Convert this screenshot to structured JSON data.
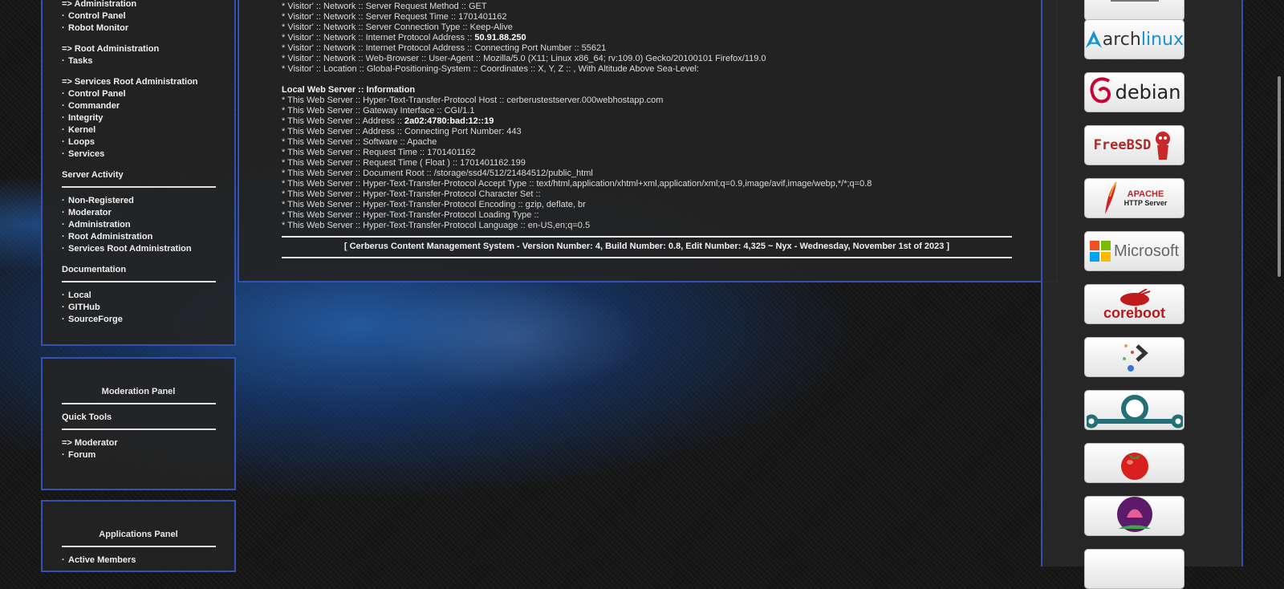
{
  "nav_panel": {
    "top_links": [
      {
        "label": "=> Administration",
        "bullet": false
      },
      {
        "label": "Control Panel",
        "bullet": true
      },
      {
        "label": "Robot Monitor",
        "bullet": true
      }
    ],
    "root_admin": {
      "head": "=> Root Administration",
      "items": [
        "Tasks"
      ]
    },
    "services_root": {
      "head": "=> Services Root Administration",
      "items": [
        "Control Panel",
        "Commander",
        "Integrity",
        "Kernel",
        "Loops",
        "Services"
      ]
    },
    "server_activity": {
      "title": "Server Activity",
      "items": [
        "Non-Registered",
        "Moderator",
        "Administration",
        "Root Administration",
        "Services Root Administration"
      ]
    },
    "documentation": {
      "title": "Documentation",
      "items": [
        "Local",
        "GITHub",
        "SourceForge"
      ]
    }
  },
  "moderation_panel": {
    "title": "Moderation Panel",
    "quick_tools": "Quick Tools",
    "head": "=> Moderator",
    "items": [
      "Forum"
    ]
  },
  "applications_panel": {
    "title": "Applications Panel",
    "items": [
      "Active Members"
    ]
  },
  "visitor_info": [
    {
      "text": "* Visitor' :: Network :: Server Request Method :: GET"
    },
    {
      "text": "* Visitor' :: Network :: Server Request Time :: 1701401162"
    },
    {
      "text": "* Visitor' :: Network :: Server Connection Type :: Keep-Alive"
    },
    {
      "text": "* Visitor' :: Network :: Internet Protocol Address :: ",
      "bold": "50.91.88.250"
    },
    {
      "text": "* Visitor' :: Network :: Internet Protocol Address :: Connecting Port Number :: 55621"
    },
    {
      "text": "* Visitor' :: Network :: Web-Browser :: User-Agent :: Mozilla/5.0 (X11; Linux x86_64; rv:109.0) Gecko/20100101 Firefox/119.0"
    },
    {
      "text": "* Visitor' :: Location :: Global-Positioning-System :: Coordinates :: X, Y, Z ::  ,  With Altitude Above Sea-Level:"
    }
  ],
  "server_info_head": "Local Web Server :: Information",
  "server_info": [
    {
      "text": "* This Web Server :: Hyper-Text-Transfer-Protocol Host :: cerberustestserver.000webhostapp.com"
    },
    {
      "text": "* This Web Server :: Gateway Interface :: CGI/1.1"
    },
    {
      "text": "* This Web Server :: Address :: ",
      "bold": "2a02:4780:bad:12::19"
    },
    {
      "text": "* This Web Server :: Address :: Connecting Port Number: 443"
    },
    {
      "text": "* This Web Server :: Software :: Apache"
    },
    {
      "text": "* This Web Server :: Request Time :: 1701401162"
    },
    {
      "text": "* This Web Server :: Request Time ( Float ) :: 1701401162.199"
    },
    {
      "text": "* This Web Server :: Document Root :: /storage/ssd4/512/21484512/public_html"
    },
    {
      "text": "* This Web Server :: Hyper-Text-Transfer-Protocol Accept Type :: text/html,application/xhtml+xml,application/xml;q=0.9,image/avif,image/webp,*/*;q=0.8"
    },
    {
      "text": "* This Web Server :: Hyper-Text-Transfer-Protocol Character Set ::"
    },
    {
      "text": "* This Web Server :: Hyper-Text-Transfer-Protocol Encoding :: gzip, deflate, br"
    },
    {
      "text": "* This Web Server :: Hyper-Text-Transfer-Protocol Loading Type ::"
    },
    {
      "text": "* This Web Server :: Hyper-Text-Transfer-Protocol Language :: en-US,en;q=0.5"
    }
  ],
  "footer": "[ Cerberus Content Management System - Version Number: 4, Build Number: 0.8, Edit Number: 4,325 ~ Nyx - Wednesday, November 1st of 2023 ]",
  "badges": [
    {
      "name": "archlinux-badge",
      "text_a": "arch",
      "text_b": "linux"
    },
    {
      "name": "debian-badge",
      "text": "debian"
    },
    {
      "name": "freebsd-badge",
      "text": "FreeBSD"
    },
    {
      "name": "apache-badge",
      "text": "APACHE",
      "sub": "HTTP Server"
    },
    {
      "name": "microsoft-badge",
      "text": "Microsoft"
    },
    {
      "name": "coreboot-badge",
      "text": "coreboot"
    },
    {
      "name": "prompt-badge"
    },
    {
      "name": "ring-badge"
    },
    {
      "name": "tomato-badge"
    },
    {
      "name": "lotus-badge"
    }
  ],
  "colors": {
    "border": "#3550b0",
    "panel": "#242424"
  }
}
